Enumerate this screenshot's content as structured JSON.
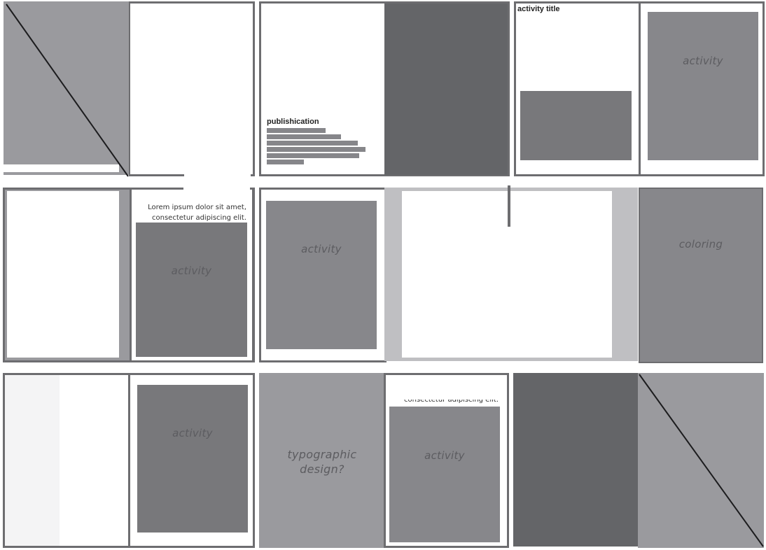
{
  "spreads": {
    "row1": {
      "publication_title": "publishication",
      "activity_title": "activity title",
      "activity_label": "activity"
    },
    "row2": {
      "lorem_line1": "Lorem ipsum dolor sit amet,",
      "lorem_line2": "consectetur adipiscing elit.",
      "activity_left": "activity",
      "activity_mid": "activity",
      "coloring_label": "coloring"
    },
    "row3": {
      "activity_left": "activity",
      "typographic_line1": "typographic",
      "typographic_line2": "design?",
      "cropped_text": "consectetur adipiscing elit.",
      "activity_mid": "activity"
    }
  },
  "colors": {
    "frame": "#6d6d70",
    "light_gray": "#9a9a9e",
    "mid_gray": "#87878b",
    "dark_gray": "#646568",
    "box_gray": "#78787b",
    "pale_gray": "#bfbfc2"
  }
}
